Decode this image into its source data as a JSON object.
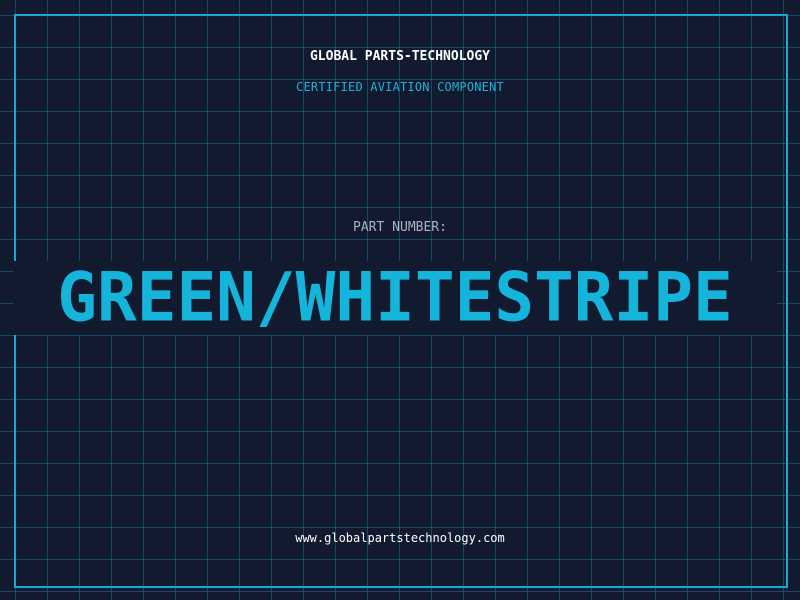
{
  "header": {
    "company": "GLOBAL PARTS-TECHNOLOGY",
    "tagline": "CERTIFIED AVIATION COMPONENT"
  },
  "part": {
    "label": "PART NUMBER:",
    "value": "GREEN/WHITESTRIPE"
  },
  "footer": {
    "url": "www.globalpartstechnology.com"
  },
  "colors": {
    "background": "#111a2e",
    "grid": "#1c6e8c",
    "accent": "#1ba7cf",
    "part_number": "#14b4db",
    "label": "#a9b3c4",
    "text": "#ffffff"
  }
}
